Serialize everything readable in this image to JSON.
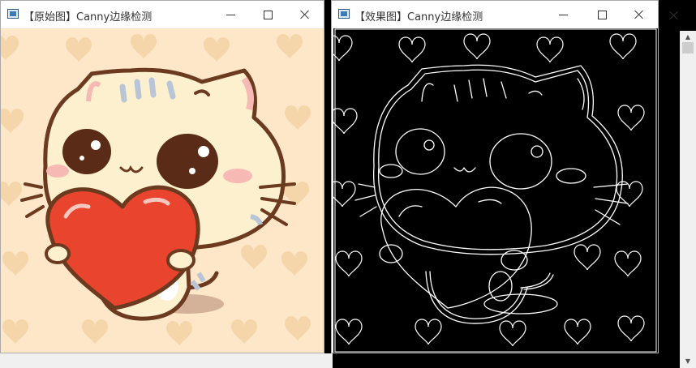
{
  "window_left": {
    "title": "【原始图】Canny边缘检测",
    "minimize_label": "minimize",
    "maximize_label": "maximize",
    "close_label": "close"
  },
  "window_right": {
    "title": "【效果图】Canny边缘检测",
    "minimize_label": "minimize",
    "maximize_label": "maximize",
    "close_label": "close"
  },
  "colors": {
    "original_bg": "#fde7c8",
    "heart_pattern": "#f4d3a5",
    "cat_face": "#fcf0cf",
    "cat_outline": "#6b3a1f",
    "big_heart": "#e8442e",
    "cheek": "#f6b9b4",
    "edge_bg": "#000000",
    "edge_line": "#ffffff"
  },
  "icons": {
    "app": "opencv-window-icon",
    "minimize": "minimize-icon",
    "maximize": "maximize-icon",
    "close": "close-icon"
  }
}
